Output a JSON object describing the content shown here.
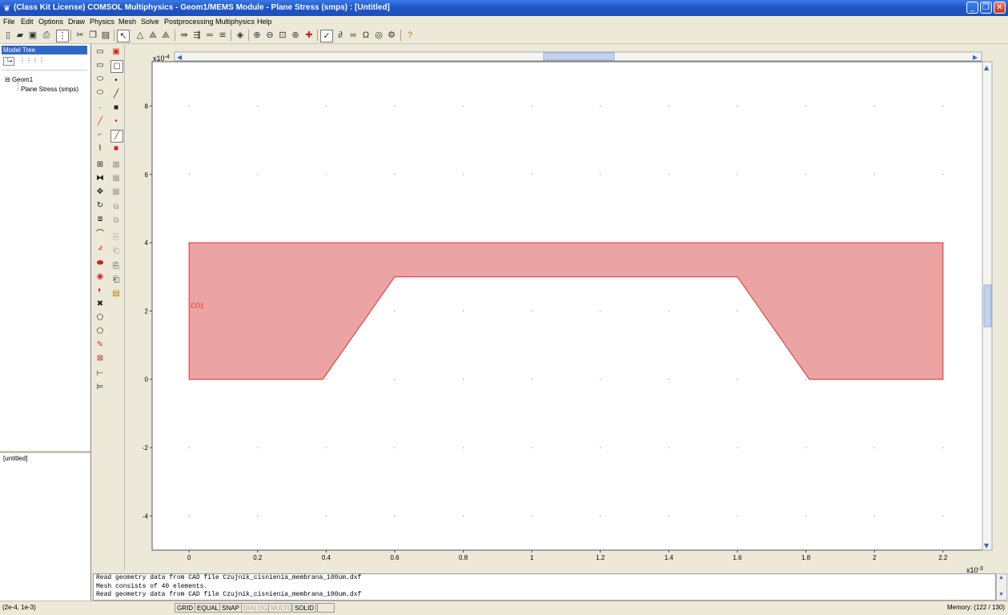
{
  "window": {
    "title": "(Class Kit License) COMSOL Multiphysics - Geom1/MEMS Module - Plane Stress (smps) : [Untitled]",
    "app_icon": "comsol-icon",
    "minimize": "_",
    "maximize": "❐",
    "close": "✕"
  },
  "menu": [
    "File",
    "Edit",
    "Options",
    "Draw",
    "Physics",
    "Mesh",
    "Solve",
    "Postprocessing",
    "Multiphysics",
    "Help"
  ],
  "toolbar_icons": [
    "new-icon",
    "open-icon",
    "save-icon",
    "print-icon",
    "model-tree-icon",
    "cut-icon",
    "copy-icon",
    "paste-icon",
    "select-icon",
    "triangle-icon",
    "mesh-icon",
    "refine-icon",
    "solve-icon",
    "restart-icon",
    "equal-icon",
    "param-icon",
    "plot-icon",
    "zoom-in-icon",
    "zoom-out-icon",
    "zoom-window-icon",
    "zoom-extents-icon",
    "axis-icon",
    "fit-icon",
    "bc-icon",
    "subdomain-icon",
    "omega-icon",
    "settings-icon",
    "plot-params-icon",
    "help-icon"
  ],
  "model_tree": {
    "header": "Model Tree",
    "nodes": [
      {
        "label": "Geom1",
        "expander": "⊟"
      },
      {
        "label": "Plane Stress (smps)"
      }
    ],
    "properties_label": "[untitled]"
  },
  "plot": {
    "x_exponent_label": "x10",
    "x_exponent_power": "-3",
    "y_exponent_label": "x10",
    "y_exponent_power": "-4",
    "x_ticks": [
      "0",
      "0.2",
      "0.4",
      "0.6",
      "0.8",
      "1",
      "1.2",
      "1.4",
      "1.6",
      "1.8",
      "2",
      "2.2"
    ],
    "x_tick_values": [
      0,
      0.2,
      0.4,
      0.6,
      0.8,
      1,
      1.2,
      1.4,
      1.6,
      1.8,
      2,
      2.2
    ],
    "y_ticks": [
      "8",
      "6",
      "4",
      "2",
      "0",
      "-2",
      "-4"
    ],
    "y_tick_values": [
      8,
      6,
      4,
      2,
      0,
      -2,
      -4
    ],
    "xlim": [
      -0.108,
      2.315
    ],
    "ylim": [
      -5.0,
      9.3
    ],
    "grid": true,
    "object_label": "CO1",
    "object_fill": "#eba3a3",
    "object_stroke": "#e03030",
    "object_vertices": [
      [
        0,
        0
      ],
      [
        0.39,
        0
      ],
      [
        0.6,
        3
      ],
      [
        1.6,
        3
      ],
      [
        1.81,
        0
      ],
      [
        2.2,
        0
      ],
      [
        2.2,
        4
      ],
      [
        0,
        4
      ]
    ]
  },
  "console": [
    "Read geometry data from CAD file Czujnik_cisnienia_membrana_100um.dxf",
    "Mesh consists of 40 elements.",
    "Read geometry data from CAD file Czujnik_cisnienia_membrana_100um.dxf"
  ],
  "status": {
    "coords": "(2e-4, 1e-3)",
    "buttons": [
      {
        "label": "GRID",
        "active": true
      },
      {
        "label": "EQUAL",
        "active": true
      },
      {
        "label": "SNAP",
        "active": true
      },
      {
        "label": "DIALOG",
        "active": false
      },
      {
        "label": "MULTI",
        "active": false
      },
      {
        "label": "SOLID",
        "active": true
      }
    ],
    "memory": "Memory: (122 / 130)"
  }
}
